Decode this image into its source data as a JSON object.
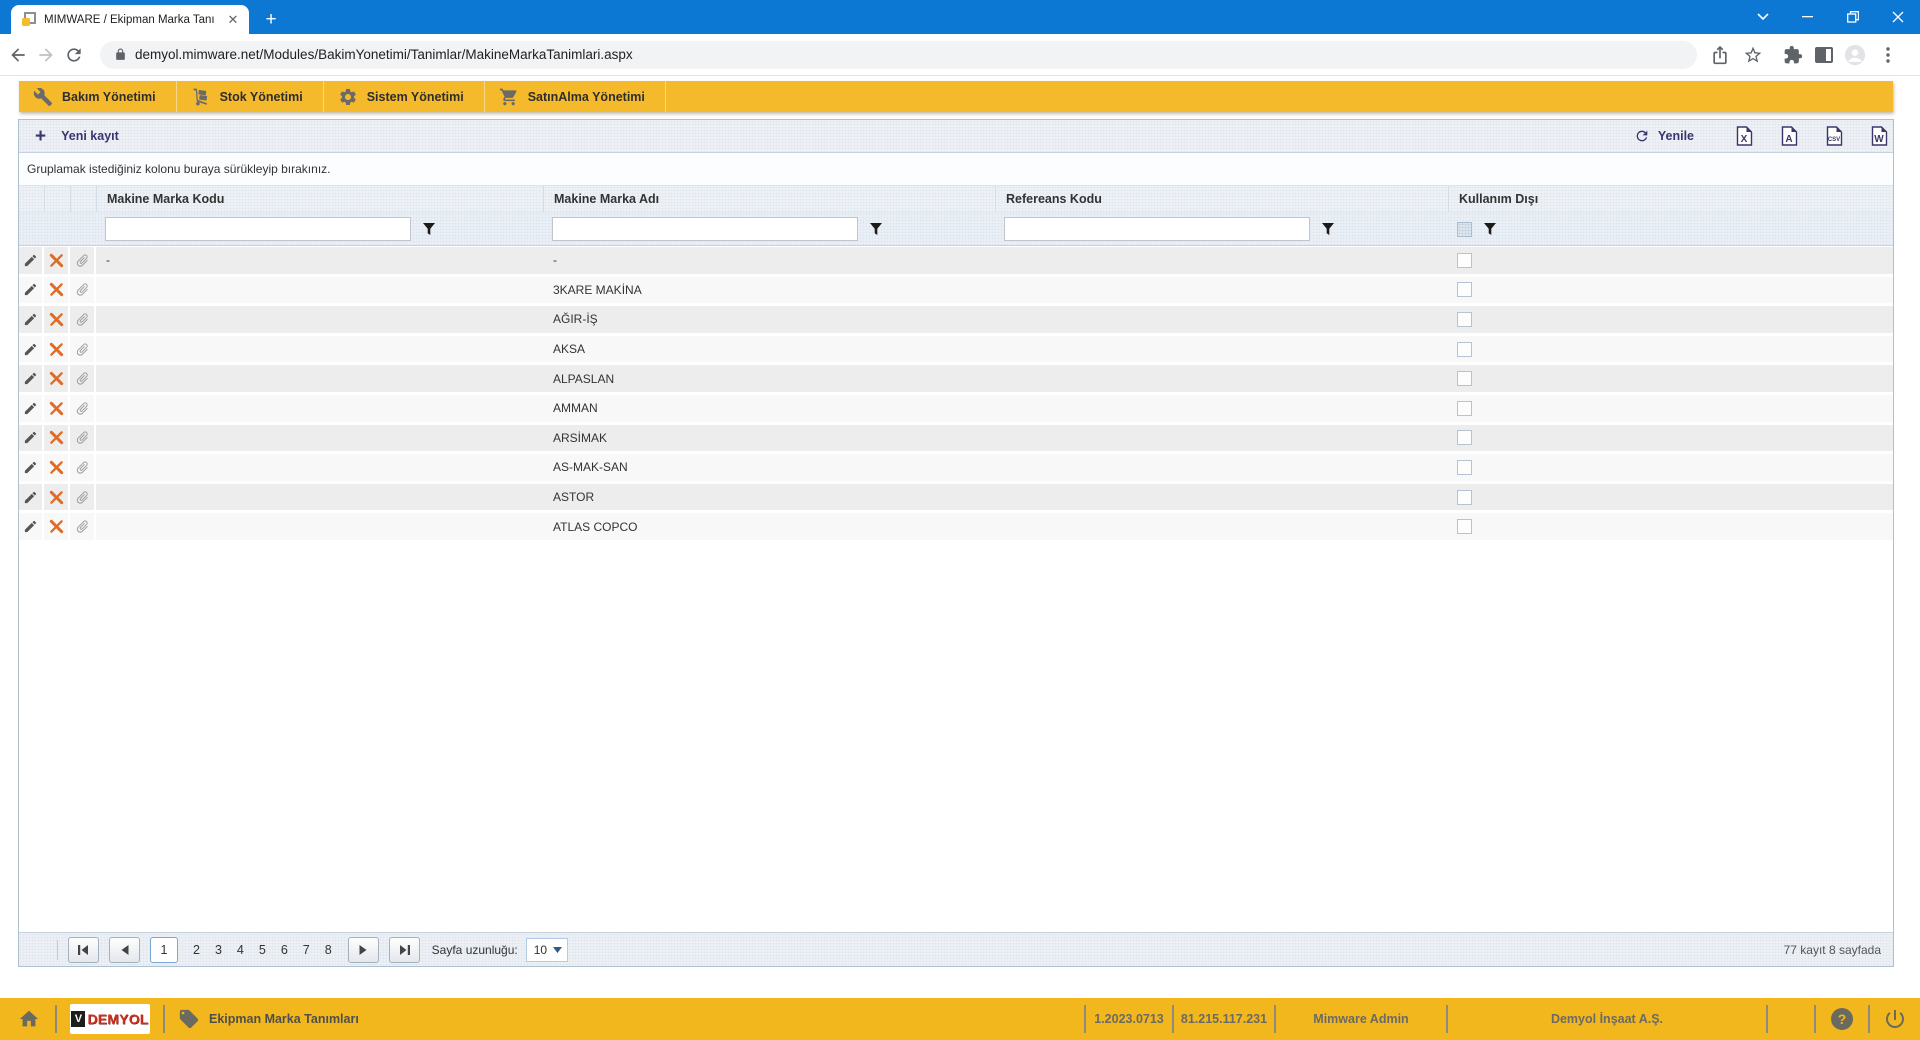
{
  "browser": {
    "tab_title": "MIMWARE / Ekipman Marka Tanı",
    "url": "demyol.mimware.net/Modules/BakimYonetimi/Tanimlar/MakineMarkaTanimlari.aspx"
  },
  "menu": {
    "items": [
      {
        "label": "Bakım Yönetimi",
        "icon": "wrench"
      },
      {
        "label": "Stok Yönetimi",
        "icon": "hand-truck"
      },
      {
        "label": "Sistem Yönetimi",
        "icon": "gear"
      },
      {
        "label": "SatınAlma Yönetimi",
        "icon": "shopping-cart"
      }
    ]
  },
  "toolbar": {
    "new_record_label": "Yeni kayıt",
    "refresh_label": "Yenile",
    "export_icons": [
      "excel",
      "pdf",
      "csv",
      "word"
    ]
  },
  "grid": {
    "group_hint": "Gruplamak istediğiniz kolonu buraya sürükleyip bırakınız.",
    "columns": {
      "kodu": "Makine Marka Kodu",
      "adi": "Makine Marka Adı",
      "ref": "Refereans Kodu",
      "kul": "Kullanım Dışı"
    },
    "rows": [
      {
        "kodu": "-",
        "adi": "-"
      },
      {
        "kodu": "",
        "adi": "3KARE MAKİNA"
      },
      {
        "kodu": "",
        "adi": "AĞIR-İŞ"
      },
      {
        "kodu": "",
        "adi": "AKSA"
      },
      {
        "kodu": "",
        "adi": "ALPASLAN"
      },
      {
        "kodu": "",
        "adi": "AMMAN"
      },
      {
        "kodu": "",
        "adi": "ARSİMAK"
      },
      {
        "kodu": "",
        "adi": "AS-MAK-SAN"
      },
      {
        "kodu": "",
        "adi": "ASTOR"
      },
      {
        "kodu": "",
        "adi": "ATLAS COPCO"
      }
    ]
  },
  "pager": {
    "current": "1",
    "pages": [
      "2",
      "3",
      "4",
      "5",
      "6",
      "7",
      "8"
    ],
    "page_size_label": "Sayfa uzunluğu:",
    "page_size": "10",
    "summary": "77 kayıt 8 sayfada"
  },
  "statusbar": {
    "logo_text": "DEMYOL",
    "page_name": "Ekipman Marka Tanımları",
    "version": "1.2023.0713",
    "ip": "81.215.117.231",
    "user": "Mimware Admin",
    "company": "Demyol İnşaat A.Ş."
  }
}
